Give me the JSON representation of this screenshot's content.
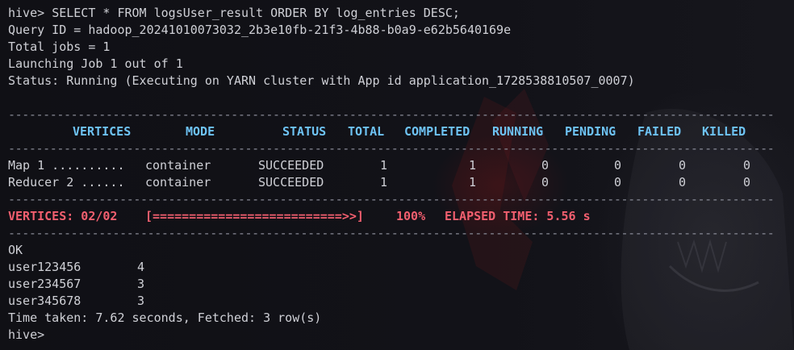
{
  "terminal": {
    "prompt": "hive>",
    "command": "SELECT * FROM logsUser_result ORDER BY log_entries DESC;",
    "query_id_line": "Query ID = hadoop_20241010073032_2b3e10fb-21f3-4b88-b0a9-e62b5640169e",
    "total_jobs_line": "Total jobs = 1",
    "launching_line": "Launching Job 1 out of 1",
    "status_line": "Status: Running (Executing on YARN cluster with App id application_1728538810507_0007)",
    "separator": "--------------------------------------------------------------------------------------------------------------"
  },
  "tez_table": {
    "headers": {
      "vertices": "VERTICES",
      "mode": "MODE",
      "status": "STATUS",
      "total": "TOTAL",
      "completed": "COMPLETED",
      "running": "RUNNING",
      "pending": "PENDING",
      "failed": "FAILED",
      "killed": "KILLED"
    },
    "rows": [
      {
        "vertex": "Map 1 ..........",
        "mode": "container",
        "status": "SUCCEEDED",
        "total": "1",
        "completed": "1",
        "running": "0",
        "pending": "0",
        "failed": "0",
        "killed": "0"
      },
      {
        "vertex": "Reducer 2 ......",
        "mode": "container",
        "status": "SUCCEEDED",
        "total": "1",
        "completed": "1",
        "running": "0",
        "pending": "0",
        "failed": "0",
        "killed": "0"
      }
    ],
    "progress": {
      "vertices_label": "VERTICES: 02/02",
      "bar": "[==========================>>]",
      "percent": "100%",
      "elapsed": "ELAPSED TIME: 5.56 s"
    }
  },
  "result": {
    "ok": "OK",
    "rows": [
      {
        "user": "user123456",
        "count": "4"
      },
      {
        "user": "user234567",
        "count": "3"
      },
      {
        "user": "user345678",
        "count": "3"
      }
    ],
    "time_line": "Time taken: 7.62 seconds, Fetched: 3 row(s)"
  },
  "colors": {
    "background": "#0f0f14",
    "text": "#cfd0d6",
    "header": "#6ec3f5",
    "progress_red": "#f25f6f",
    "separator": "#8a8c98"
  }
}
